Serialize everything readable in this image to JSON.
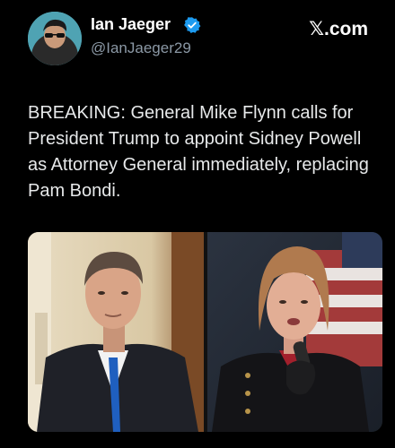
{
  "author": {
    "name": "Ian Jaeger",
    "handle": "@IanJaeger29",
    "verified": true,
    "badge_color": "#1d9bf0"
  },
  "platform": {
    "label": "𝕏.com"
  },
  "tweet": {
    "text": "BREAKING: General Mike Flynn calls for President Trump to appoint Sidney Powell as Attorney General immediately, replacing Pam Bondi."
  },
  "media": {
    "images": [
      {
        "icon": "photo-man-dark-suit-blue-tie"
      },
      {
        "icon": "photo-woman-speaking-microphone"
      }
    ]
  },
  "colors": {
    "background": "#000000",
    "text": "#e7e9ea",
    "secondary_text": "#8b98a5"
  }
}
